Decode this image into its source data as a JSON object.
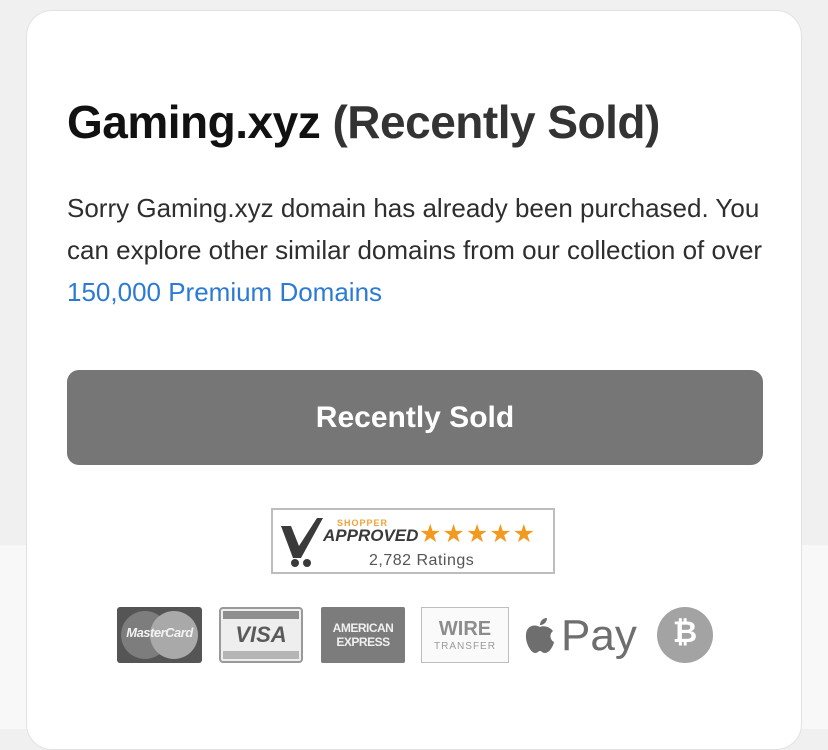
{
  "domain_card": {
    "title_domain": "Gaming.xyz",
    "title_status": "(Recently Sold)",
    "description_line": "Sorry Gaming.xyz domain has already been purchased. You can explore other similar domains from our collection of over",
    "premium_link_text": "150,000 Premium Domains",
    "button_label": "Recently Sold"
  },
  "shopper_approved": {
    "brand_small": "SHOPPER",
    "brand": "APPROVED",
    "stars": "★★★★★",
    "ratings_text": "2,782 Ratings"
  },
  "payment_methods": {
    "mastercard": "MasterCard",
    "visa": "VISA",
    "amex_line1": "AMERICAN",
    "amex_line2": "EXPRESS",
    "wire_line1": "WIRE",
    "wire_line2": "TRANSFER",
    "applepay": "Pay",
    "bitcoin": "₿"
  },
  "colors": {
    "link": "#2b7bd6",
    "button_bg": "#767676",
    "stars": "#f29a1f"
  }
}
